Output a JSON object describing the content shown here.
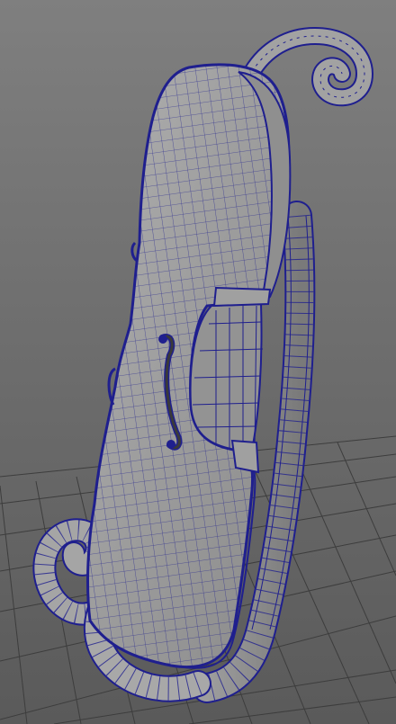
{
  "viewport": {
    "background_top": "#7f7f7f",
    "background_bottom": "#595959",
    "grid_color": "#3e3e3e",
    "wire_color": "#1f1f8e",
    "surface_light": "#a9a9a9",
    "surface_mid": "#8d8d8d",
    "surface_dark": "#6e6e6e"
  },
  "scene": {
    "object": "violin-body-wireframe"
  }
}
